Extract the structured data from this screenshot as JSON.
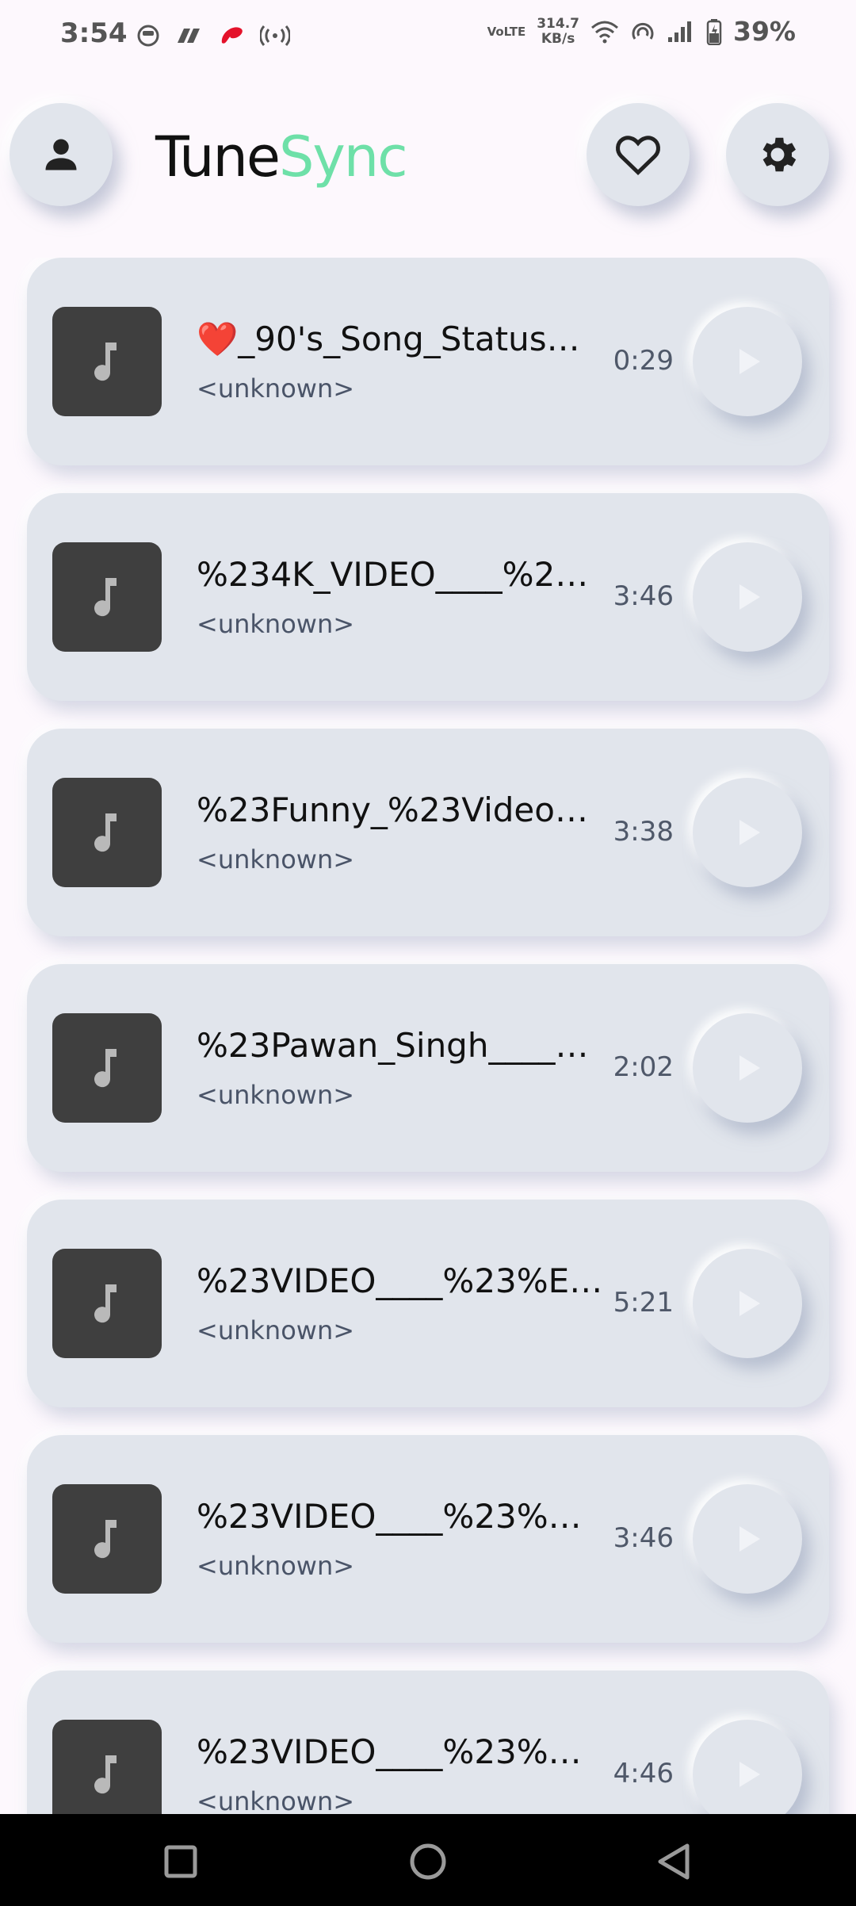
{
  "status_bar": {
    "time": "3:54",
    "network_type": "VoLTE",
    "net_speed_value": "314.7",
    "net_speed_unit": "KB/s",
    "battery": "39%"
  },
  "header": {
    "title_part1": "Tune",
    "title_part2": "Sync",
    "title_color_1": "#111111",
    "title_color_2": "#6ee0a8"
  },
  "songs": [
    {
      "title": "❤️_90's_Song_Status…",
      "artist": "<unknown>",
      "duration": "0:29"
    },
    {
      "title": "%234K_VIDEO____%2…",
      "artist": "<unknown>",
      "duration": "3:46"
    },
    {
      "title": "%23Funny_%23Video…",
      "artist": "<unknown>",
      "duration": "3:38"
    },
    {
      "title": "%23Pawan_Singh____…",
      "artist": "<unknown>",
      "duration": "2:02"
    },
    {
      "title": "%23VIDEO____%23%E…",
      "artist": "<unknown>",
      "duration": "5:21"
    },
    {
      "title": "%23VIDEO____%23%…",
      "artist": "<unknown>",
      "duration": "3:46"
    },
    {
      "title": "%23VIDEO____%23%…",
      "artist": "<unknown>",
      "duration": "4:46"
    }
  ],
  "icons": {
    "profile": "person-icon",
    "favorite": "heart-icon",
    "settings": "gear-icon",
    "album_art": "music-note-icon",
    "play": "play-icon"
  }
}
